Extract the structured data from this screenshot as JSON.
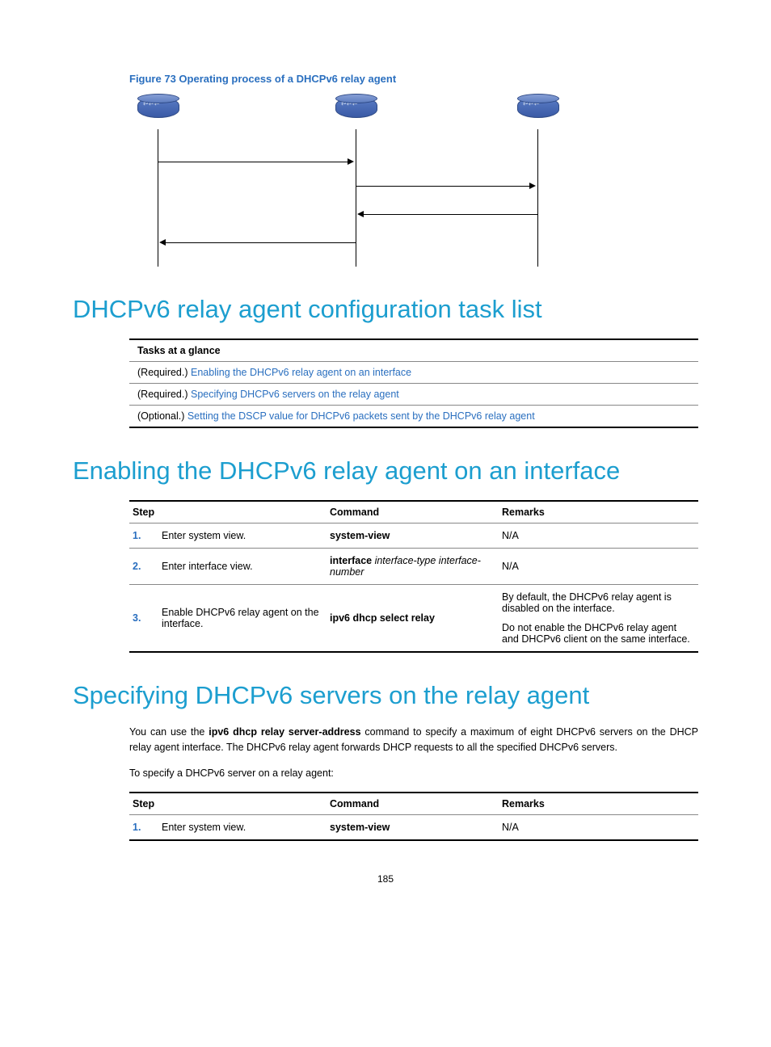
{
  "figure_caption": "Figure 73 Operating process of a DHCPv6 relay agent",
  "section1_title": "DHCPv6 relay agent configuration task list",
  "tasks": {
    "header": "Tasks at a glance",
    "rows": [
      {
        "prefix": "(Required.) ",
        "link": "Enabling the DHCPv6 relay agent on an interface"
      },
      {
        "prefix": "(Required.) ",
        "link": "Specifying DHCPv6 servers on the relay agent"
      },
      {
        "prefix": "(Optional.) ",
        "link": "Setting the DSCP value for DHCPv6 packets sent by the DHCPv6 relay agent"
      }
    ]
  },
  "section2_title": "Enabling the DHCPv6 relay agent on an interface",
  "step_headers": {
    "step": "Step",
    "command": "Command",
    "remarks": "Remarks"
  },
  "steps2": [
    {
      "num": "1.",
      "desc": "Enter system view.",
      "cmd_bold": "system-view",
      "remarks": "N/A"
    },
    {
      "num": "2.",
      "desc": "Enter interface view.",
      "cmd_bold": "interface",
      "cmd_italic": " interface-type interface-number",
      "remarks": "N/A"
    },
    {
      "num": "3.",
      "desc": "Enable DHCPv6 relay agent on the interface.",
      "cmd_bold": "ipv6 dhcp select relay",
      "remarks": "By default, the DHCPv6 relay agent is disabled on the interface.",
      "remarks2": "Do not enable the DHCPv6 relay agent and DHCPv6 client on the same interface."
    }
  ],
  "section3_title": "Specifying DHCPv6 servers on the relay agent",
  "para1_a": "You can use the ",
  "para1_cmd": "ipv6 dhcp relay server-address",
  "para1_b": " command to specify a maximum of eight DHCPv6 servers on the DHCP relay agent interface. The DHCPv6 relay agent forwards DHCP requests to all the specified DHCPv6 servers.",
  "para2": "To specify a DHCPv6 server on a relay agent:",
  "steps3": [
    {
      "num": "1.",
      "desc": "Enter system view.",
      "cmd_bold": "system-view",
      "remarks": "N/A"
    }
  ],
  "page_number": "185"
}
